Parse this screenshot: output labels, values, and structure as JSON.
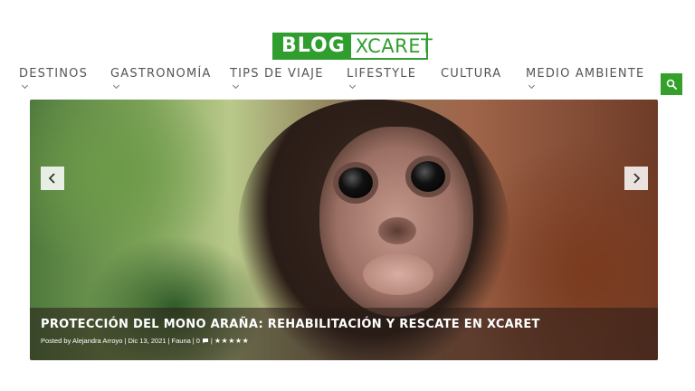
{
  "header": {
    "logo": {
      "part1": "BLOG",
      "part2": "XCARET"
    }
  },
  "nav": {
    "items": [
      {
        "label": "DESTINOS"
      },
      {
        "label": "GASTRONOMÍA"
      },
      {
        "label": "TIPS DE VIAJE"
      },
      {
        "label": "LIFESTYLE"
      },
      {
        "label": "CULTURA"
      },
      {
        "label": "MEDIO AMBIENTE"
      }
    ],
    "search_icon": "search-icon"
  },
  "slider": {
    "title": "PROTECCIÓN DEL MONO ARAÑA: REHABILITACIÓN Y RESCATE EN XCARET",
    "meta": {
      "posted_by": "Posted by Alejandra Arroyo",
      "date": "Dic 13, 2021",
      "category": "Fauna",
      "comments": "0",
      "separator": "|"
    },
    "rating_stars": 5
  },
  "colors": {
    "brand_green": "#2f9e2f",
    "search_green": "#33a02c"
  }
}
